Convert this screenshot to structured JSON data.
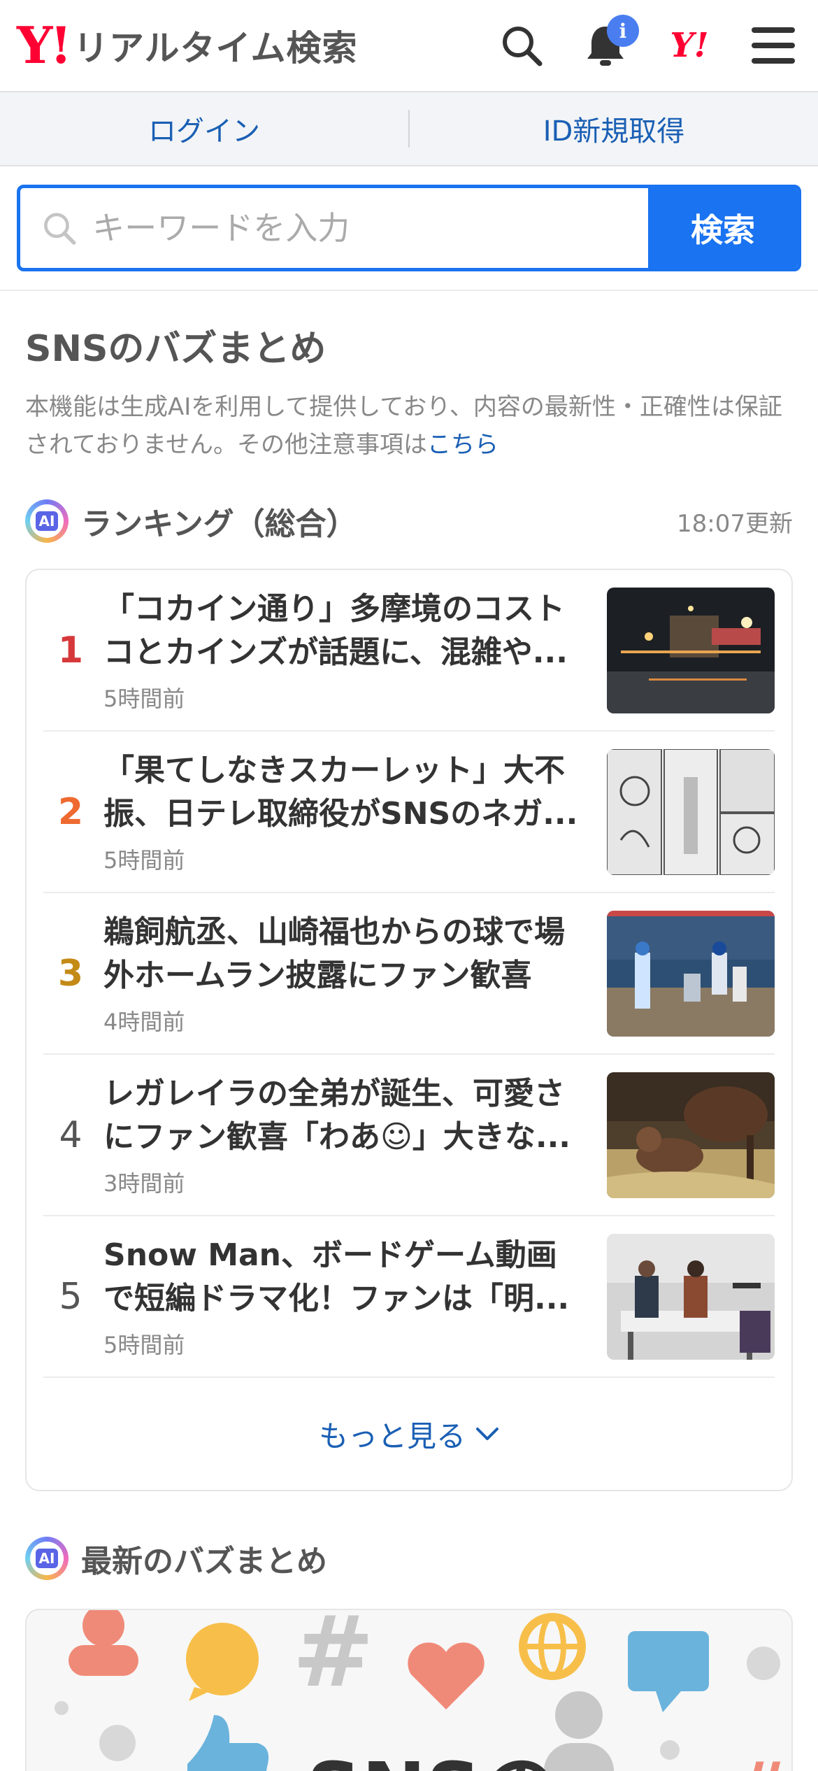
{
  "header": {
    "logo_mark": "Y!",
    "logo_text": "リアルタイム検索",
    "notification_badge": "i",
    "yahoo_mark": "Y!"
  },
  "auth": {
    "login": "ログイン",
    "register": "ID新規取得"
  },
  "search": {
    "placeholder": "キーワードを入力",
    "button": "検索"
  },
  "buzz": {
    "title": "SNSのバズまとめ",
    "note": "本機能は生成AIを利用して提供しており、内容の最新性・正確性は保証されておりません。その他注意事項は",
    "note_link": "こちら"
  },
  "ranking": {
    "ai_badge": "AI",
    "title": "ランキング（総合）",
    "updated": "18:07更新",
    "rank_colors": [
      "#d6383a",
      "#ee6a30",
      "#c48a16",
      "#555555",
      "#555555"
    ],
    "items": [
      {
        "rank": "1",
        "title": "「コカイン通り」多摩境のコストコとカインズが話題に、混雑や...",
        "time": "5時間前"
      },
      {
        "rank": "2",
        "title": "「果てしなきスカーレット」大不振、日テレ取締役がSNSのネガ...",
        "time": "5時間前"
      },
      {
        "rank": "3",
        "title": "鵜飼航丞、山崎福也からの球で場外ホームラン披露にファン歓喜",
        "time": "4時間前"
      },
      {
        "rank": "4",
        "title": "レガレイラの全弟が誕生、可愛さにファン歓喜「わあ☺」大きな...",
        "time": "3時間前"
      },
      {
        "rank": "5",
        "title": "Snow Man、ボードゲーム動画で短編ドラマ化！ファンは「明...",
        "time": "5時間前"
      }
    ],
    "more": "もっと見る"
  },
  "latest": {
    "ai_badge": "AI",
    "title": "最新のバズまとめ",
    "banner_text": "SNSの"
  }
}
